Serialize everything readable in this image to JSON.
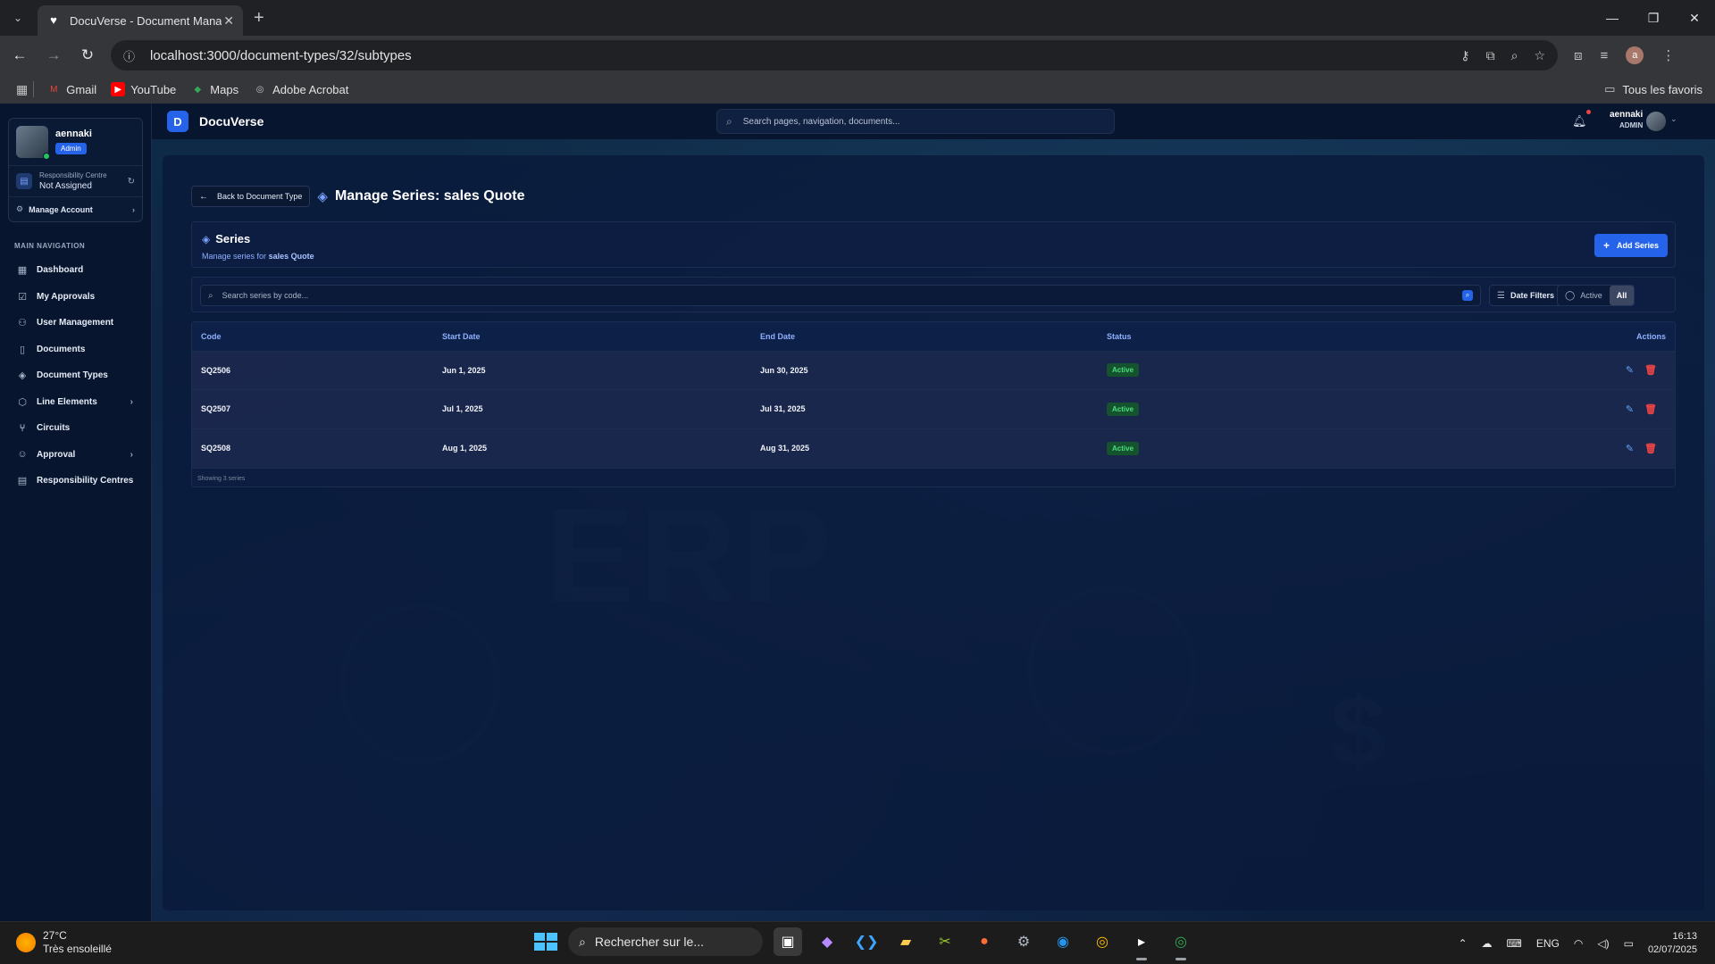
{
  "browser": {
    "tab_title": "DocuVerse - Document Manage",
    "url": "localhost:3000/document-types/32/subtypes",
    "bookmarks": [
      {
        "label": "Gmail",
        "icon": "gmail-icon",
        "color": "#ea4335"
      },
      {
        "label": "YouTube",
        "icon": "youtube-icon",
        "color": "#ff0000"
      },
      {
        "label": "Maps",
        "icon": "maps-icon",
        "color": "#34a853"
      },
      {
        "label": "Adobe Acrobat",
        "icon": "acrobat-icon",
        "color": "#9aa0a6"
      }
    ],
    "all_bookmarks": "Tous les favoris",
    "profile_initial": "a"
  },
  "sidebar": {
    "user_name": "aennaki",
    "user_badge": "Admin",
    "resp_label": "Responsibility Centre",
    "resp_value": "Not Assigned",
    "manage_account": "Manage Account",
    "nav_title": "MAIN NAVIGATION",
    "items": [
      {
        "label": "Dashboard",
        "icon": "dashboard-icon"
      },
      {
        "label": "My Approvals",
        "icon": "clipboard-icon"
      },
      {
        "label": "User Management",
        "icon": "users-icon"
      },
      {
        "label": "Documents",
        "icon": "document-icon"
      },
      {
        "label": "Document Types",
        "icon": "layers-icon"
      },
      {
        "label": "Line Elements",
        "icon": "box-icon"
      },
      {
        "label": "Circuits",
        "icon": "branch-icon"
      },
      {
        "label": "Approval",
        "icon": "user-check-icon"
      },
      {
        "label": "Responsibility Centres",
        "icon": "building-icon"
      }
    ]
  },
  "topbar": {
    "logo_letter": "D",
    "brand": "DocuVerse",
    "search_placeholder": "Search pages, navigation, documents...",
    "user_name": "aennaki",
    "user_role": "ADMIN"
  },
  "page": {
    "back_label": "Back to Document Type",
    "title": "Manage Series: sales Quote",
    "series_title": "Series",
    "series_sub_prefix": "Manage series for",
    "series_sub_name": "sales Quote",
    "add_label": "Add Series",
    "search_placeholder": "Search series by code...",
    "date_filters": "Date Filters",
    "toggle_active": "Active",
    "toggle_all": "All",
    "columns": [
      "Code",
      "Start Date",
      "End Date",
      "Status",
      "Actions"
    ],
    "rows": [
      {
        "code": "SQ2506",
        "start": "Jun 1, 2025",
        "end": "Jun 30, 2025",
        "status": "Active"
      },
      {
        "code": "SQ2507",
        "start": "Jul 1, 2025",
        "end": "Jul 31, 2025",
        "status": "Active"
      },
      {
        "code": "SQ2508",
        "start": "Aug 1, 2025",
        "end": "Aug 31, 2025",
        "status": "Active"
      }
    ],
    "showing": "Showing 3 series"
  },
  "taskbar": {
    "temperature": "27°C",
    "weather": "Très ensoleillé",
    "search_placeholder": "Rechercher sur le...",
    "lang": "ENG",
    "time": "16:13",
    "date": "02/07/2025"
  }
}
